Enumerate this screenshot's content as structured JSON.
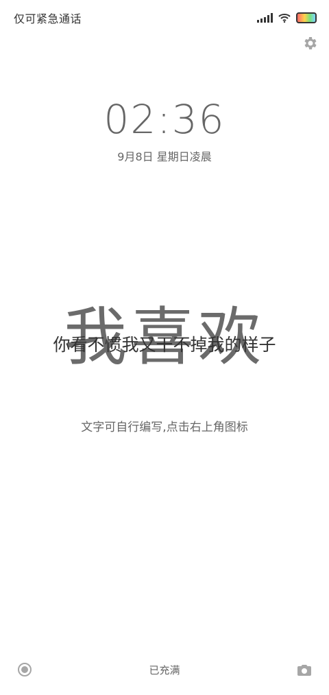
{
  "status_bar": {
    "carrier_text": "仅可紧急通话",
    "icons": [
      "signal-icon",
      "wifi-icon",
      "battery-icon"
    ]
  },
  "lockscreen": {
    "time": "02:36",
    "date": "9月8日 星期日凌晨",
    "headline": "我喜欢",
    "overlay": "你看不惯我又干不掉我的样子",
    "hint": "文字可自行编写,点击右上角图标",
    "charge_status": "已充满"
  },
  "bottom_icons": [
    "target-icon",
    "camera-icon"
  ],
  "colors": {
    "background": "#ffffff",
    "text_primary": "#333333",
    "text_secondary": "#666666",
    "headline": "#6b6b6b"
  }
}
